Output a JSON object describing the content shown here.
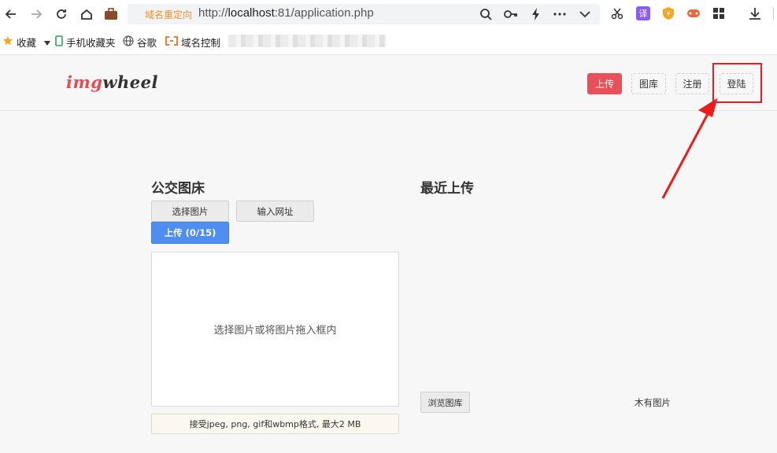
{
  "browser": {
    "redirect_tag": "域名重定向",
    "url_prefix": "http://",
    "url_host": "localhost",
    "url_rest": ":81/application.php"
  },
  "bookmarks": {
    "items": [
      {
        "label": "收藏",
        "icon": "star-icon"
      },
      {
        "label": "手机收藏夹",
        "icon": "phone-icon"
      },
      {
        "label": "谷歌",
        "icon": "globe-icon"
      },
      {
        "label": "域名控制",
        "icon": "bracket-icon"
      }
    ]
  },
  "header": {
    "logo_accent": "img",
    "logo_rest": "wheel",
    "buttons": {
      "upload": "上传",
      "gallery": "图库",
      "register": "注册",
      "login": "登陆"
    }
  },
  "left": {
    "title": "公交图床",
    "tab_select": "选择图片",
    "tab_url": "输入网址",
    "upload_button": "上传 (0/15)",
    "dropzone_text": "选择图片或将图片拖入框内",
    "formats_text": "接受jpeg, png, gif和wbmp格式, 最大2 MB"
  },
  "right": {
    "title": "最近上传",
    "browse_button": "浏览图库",
    "empty_text": "木有图片"
  },
  "colors": {
    "brand_red": "#e7525a",
    "primary_blue": "#4d8ef0",
    "annotation_red": "#ee1b1b"
  }
}
